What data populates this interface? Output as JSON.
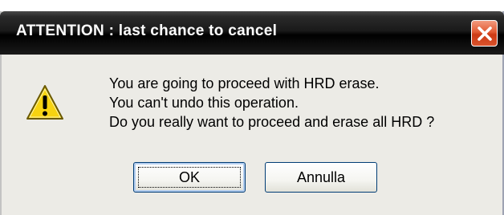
{
  "dialog": {
    "title": "ATTENTION : last chance to cancel",
    "icon": "warning-icon",
    "message_lines": [
      "You are going to proceed with HRD erase.",
      "You can't undo this operation.",
      "Do you really want to proceed and erase all HRD ?"
    ],
    "buttons": {
      "ok_label": "OK",
      "cancel_label": "Annulla"
    }
  },
  "colors": {
    "titlebar": "#000000",
    "close_button": "#e25b33",
    "dialog_background": "#ecebe6",
    "button_border": "#003c74"
  }
}
